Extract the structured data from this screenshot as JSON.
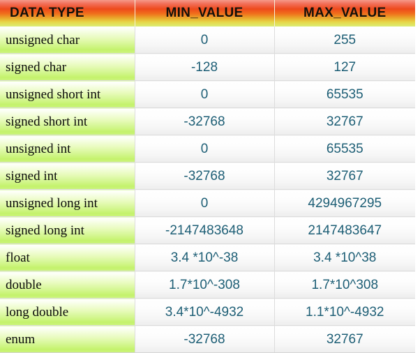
{
  "table": {
    "columns": [
      {
        "key": "data_type",
        "label": "DATA TYPE"
      },
      {
        "key": "min_value",
        "label": "MIN_VALUE"
      },
      {
        "key": "max_value",
        "label": "MAX_VALUE"
      }
    ],
    "rows": [
      {
        "data_type": "unsigned char",
        "min_value": "0",
        "max_value": "255"
      },
      {
        "data_type": "signed char",
        "min_value": "-128",
        "max_value": "127"
      },
      {
        "data_type": "unsigned short int",
        "min_value": "0",
        "max_value": "65535"
      },
      {
        "data_type": "signed short int",
        "min_value": "-32768",
        "max_value": "32767"
      },
      {
        "data_type": "unsigned int",
        "min_value": "0",
        "max_value": "65535"
      },
      {
        "data_type": "signed int",
        "min_value": "-32768",
        "max_value": "32767"
      },
      {
        "data_type": "unsigned long int",
        "min_value": "0",
        "max_value": "4294967295"
      },
      {
        "data_type": "signed long int",
        "min_value": "-2147483648",
        "max_value": "2147483647"
      },
      {
        "data_type": "float",
        "min_value": "3.4 *10^-38",
        "max_value": "3.4 *10^38"
      },
      {
        "data_type": "double",
        "min_value": "1.7*10^-308",
        "max_value": "1.7*10^308"
      },
      {
        "data_type": "long double",
        "min_value": "3.4*10^-4932",
        "max_value": "1.1*10^-4932"
      },
      {
        "data_type": "enum",
        "min_value": "-32768",
        "max_value": "32767"
      }
    ]
  },
  "colors": {
    "header_top": "#f59a8a",
    "header_mid": "#ee4a1c",
    "header_bottom": "#d8ec78",
    "type_cell_green": "#c4f26c",
    "value_text": "#1d5e75",
    "grid_line": "#dcdcdc"
  }
}
